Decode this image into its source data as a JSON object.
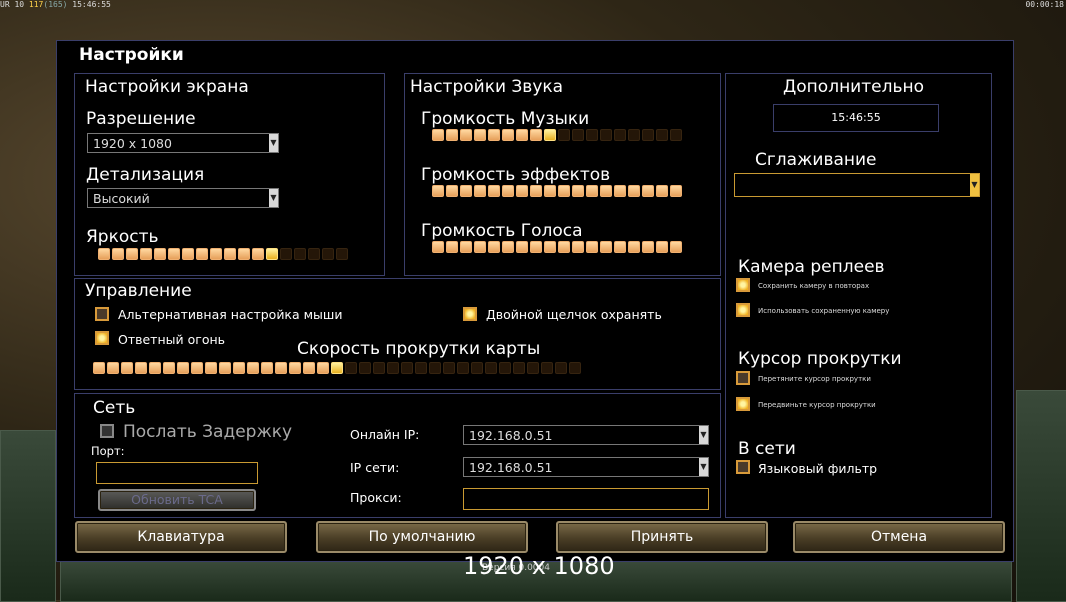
{
  "hud": {
    "left_prefix": "UR 10",
    "left_value": "117",
    "left_max": "(165)",
    "left_time": "15:46:55",
    "right_time": "00:00:18"
  },
  "dialog_title": "Настройки",
  "screen": {
    "title": "Настройки экрана",
    "resolution_label": "Разрешение",
    "resolution_value": "1920 x 1080",
    "detail_label": "Детализация",
    "detail_value": "Высокий",
    "brightness_label": "Яркость",
    "brightness_level": 0.7
  },
  "sound": {
    "title": "Настройки Звука",
    "music_label": "Громкость Музыки",
    "music_level": 0.5,
    "effects_label": "Громкость эффектов",
    "effects_level": 1.0,
    "voice_label": "Громкость Голоса",
    "voice_level": 1.0
  },
  "extra": {
    "title": "Дополнительно",
    "clock": "15:46:55",
    "antialias_label": "Сглаживание",
    "antialias_value": "",
    "replay_camera_label": "Камера реплеев",
    "replay_save_camera": "Сохранить камеру в повторах",
    "replay_use_camera": "Использовать сохраненную камеру",
    "scroll_cursor_label": "Курсор прокрутки",
    "scroll_cursor_drag": "Перетяните курсор прокрутки",
    "scroll_cursor_move": "Передвиньте курсор прокрутки",
    "online_label": "В сети",
    "language_filter": "Языковый фильтр"
  },
  "control": {
    "title": "Управление",
    "alt_mouse": "Альтернативная настройка мыши",
    "double_click": "Двойной щелчок охранять",
    "return_fire": "Ответный огонь",
    "scroll_speed_label": "Скорость прокрутки карты",
    "scroll_speed_level": 0.5
  },
  "network": {
    "title": "Сеть",
    "send_delay": "Послать Задержку",
    "port_label": "Порт:",
    "port_value": "",
    "update_tca": "Обновить TCA",
    "online_ip_label": "Онлайн IP:",
    "online_ip_value": "192.168.0.51",
    "lan_ip_label": "IP сети:",
    "lan_ip_value": "192.168.0.51",
    "proxy_label": "Прокси:",
    "proxy_value": ""
  },
  "buttons": {
    "keyboard": "Клавиатура",
    "defaults": "По умолчанию",
    "accept": "Принять",
    "cancel": "Отмена"
  },
  "overlay": {
    "resolution_text": "1920 x 1080",
    "version_text": "Версия 0.0004"
  }
}
